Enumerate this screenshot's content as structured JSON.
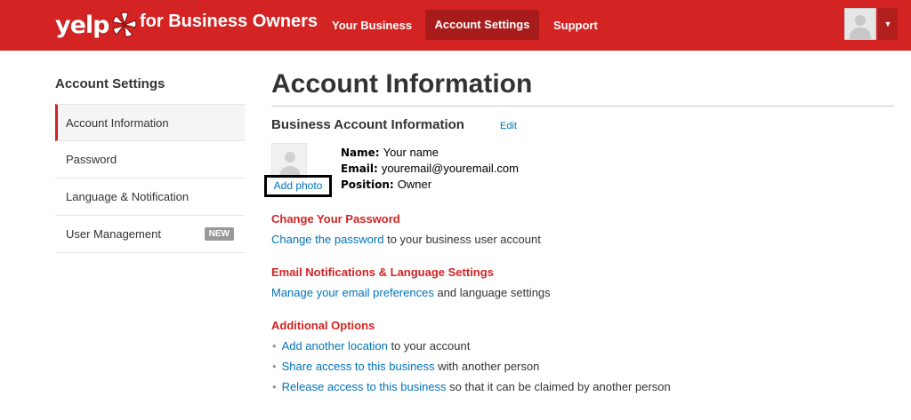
{
  "header": {
    "logo_text": "yelp",
    "brand_suffix": "for Business Owners",
    "nav": [
      {
        "label": "Your Business"
      },
      {
        "label": "Account Settings"
      },
      {
        "label": "Support"
      }
    ],
    "colors": {
      "brand_red": "#d32323",
      "active_nav": "#a81b1b",
      "link_blue": "#0073bb"
    }
  },
  "sidebar": {
    "title": "Account Settings",
    "items": [
      {
        "label": "Account Information"
      },
      {
        "label": "Password"
      },
      {
        "label": "Language & Notification"
      },
      {
        "label": "User Management",
        "badge": "NEW"
      }
    ]
  },
  "main": {
    "title": "Account Information",
    "business_section": {
      "heading": "Business Account Information",
      "edit_label": "Edit",
      "add_photo_label": "Add photo",
      "name_label": "Name:",
      "name_value": "Your name",
      "email_label": "Email:",
      "email_value": "youremail@youremail.com",
      "position_label": "Position:",
      "position_value": "Owner"
    },
    "password_section": {
      "heading": "Change Your Password",
      "link": "Change the password",
      "rest": " to your business user account"
    },
    "email_section": {
      "heading": "Email Notifications & Language Settings",
      "link": "Manage your email preferences",
      "rest": " and language settings"
    },
    "additional_section": {
      "heading": "Additional Options",
      "bullet_glyph": "•",
      "items": [
        {
          "link": "Add another location",
          "rest": " to your account"
        },
        {
          "link": "Share access to this business",
          "rest": " with another person"
        },
        {
          "link": "Release access to this business",
          "rest": " so that it can be claimed by another person"
        }
      ]
    }
  }
}
